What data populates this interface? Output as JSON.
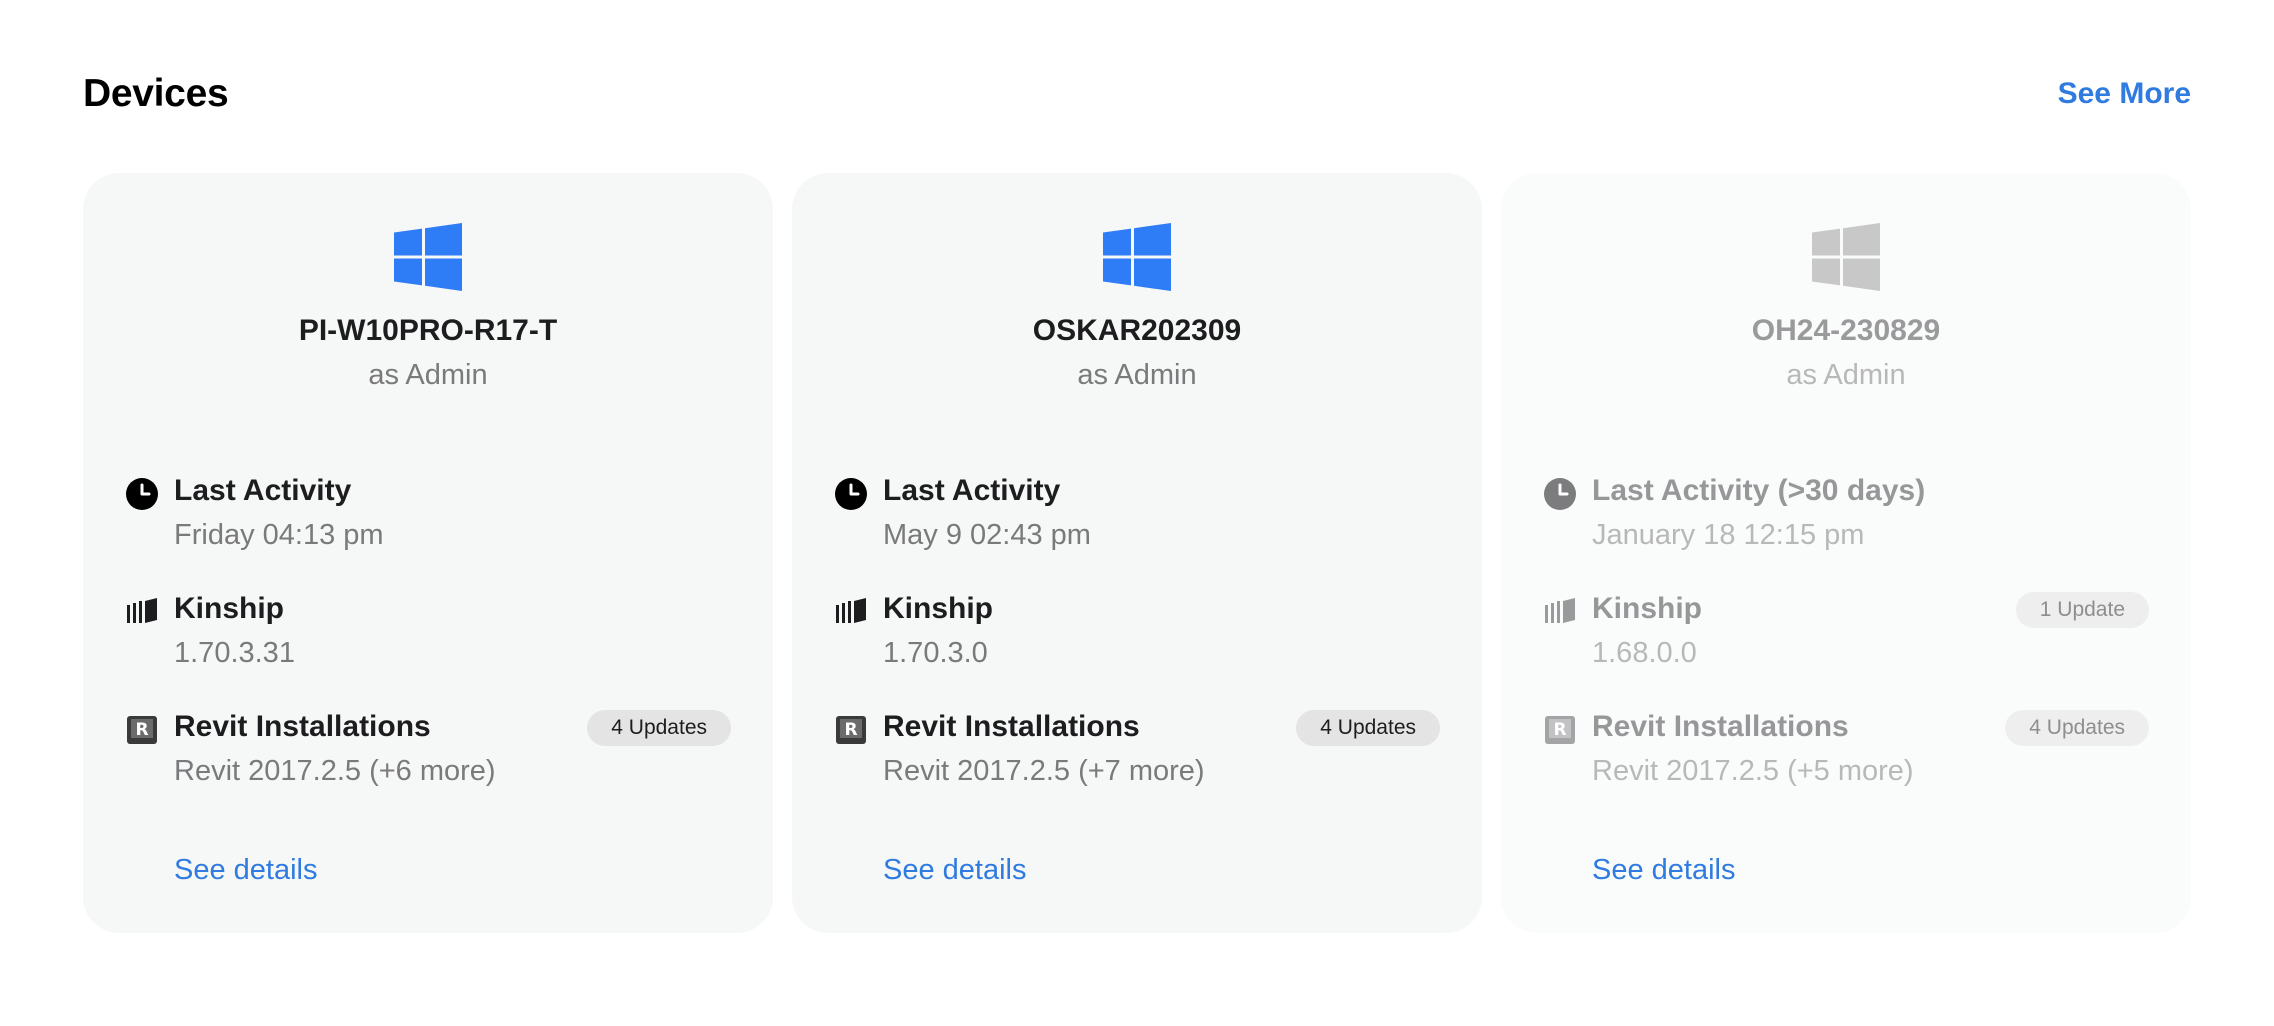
{
  "header": {
    "title": "Devices",
    "see_more_label": "See More"
  },
  "colors": {
    "accent": "#2f7be0",
    "windows_active": "#2f7df6",
    "windows_inactive": "#c8c8c8"
  },
  "devices": [
    {
      "os_icon": "windows-logo-icon",
      "name": "PI-W10PRO-R17-T",
      "role": "as Admin",
      "active": true,
      "activity": {
        "title": "Last Activity",
        "value": "Friday 04:13 pm"
      },
      "kinship": {
        "title": "Kinship",
        "value": "1.70.3.31",
        "badge": ""
      },
      "revit": {
        "title": "Revit Installations",
        "value": "Revit 2017.2.5 (+6 more)",
        "badge": "4 Updates"
      },
      "details_label": "See details"
    },
    {
      "os_icon": "windows-logo-icon",
      "name": "OSKAR202309",
      "role": "as Admin",
      "active": true,
      "activity": {
        "title": "Last Activity",
        "value": "May 9 02:43 pm"
      },
      "kinship": {
        "title": "Kinship",
        "value": "1.70.3.0",
        "badge": ""
      },
      "revit": {
        "title": "Revit Installations",
        "value": "Revit 2017.2.5 (+7 more)",
        "badge": "4 Updates"
      },
      "details_label": "See details"
    },
    {
      "os_icon": "windows-logo-icon",
      "name": "OH24-230829",
      "role": "as Admin",
      "active": false,
      "activity": {
        "title": "Last Activity (>30 days)",
        "value": "January 18 12:15 pm"
      },
      "kinship": {
        "title": "Kinship",
        "value": "1.68.0.0",
        "badge": "1 Update"
      },
      "revit": {
        "title": "Revit Installations",
        "value": "Revit 2017.2.5 (+5 more)",
        "badge": "4 Updates"
      },
      "details_label": "See details"
    }
  ]
}
